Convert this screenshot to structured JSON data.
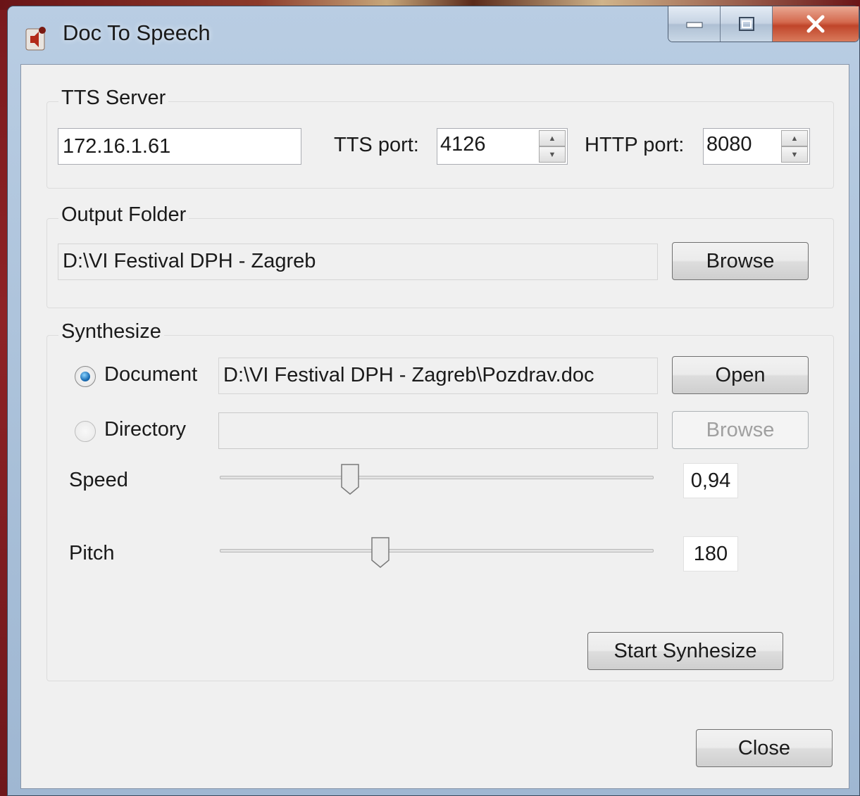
{
  "window": {
    "title": "Doc To Speech",
    "controls": {
      "minimize": "minimize",
      "maximize": "maximize",
      "close": "close"
    }
  },
  "tts_server": {
    "group_label": "TTS Server",
    "address": "172.16.1.61",
    "tts_port_label": "TTS port:",
    "tts_port": "4126",
    "http_port_label": "HTTP port:",
    "http_port": "8080"
  },
  "output_folder": {
    "group_label": "Output Folder",
    "path": "D:\\VI Festival DPH - Zagreb",
    "browse_label": "Browse"
  },
  "synthesize": {
    "group_label": "Synthesize",
    "document_label": "Document",
    "document_selected": true,
    "document_path": "D:\\VI Festival DPH - Zagreb\\Pozdrav.doc",
    "open_label": "Open",
    "directory_label": "Directory",
    "directory_selected": false,
    "directory_path": "",
    "directory_browse_label": "Browse",
    "speed_label": "Speed",
    "speed_value": "0,94",
    "speed_fraction": 0.3,
    "pitch_label": "Pitch",
    "pitch_value": "180",
    "pitch_fraction": 0.37,
    "start_label": "Start Synhesize"
  },
  "footer": {
    "close_label": "Close"
  },
  "icons": {
    "app": "speaker-icon",
    "minimize": "minimize-icon",
    "maximize": "maximize-icon",
    "close": "close-icon",
    "spin_up": "chevron-up-icon",
    "spin_down": "chevron-down-icon"
  },
  "colors": {
    "radio_selected": "#1d6fb5",
    "close_button": "#c7452a",
    "titlebar": "#b9cde3"
  }
}
